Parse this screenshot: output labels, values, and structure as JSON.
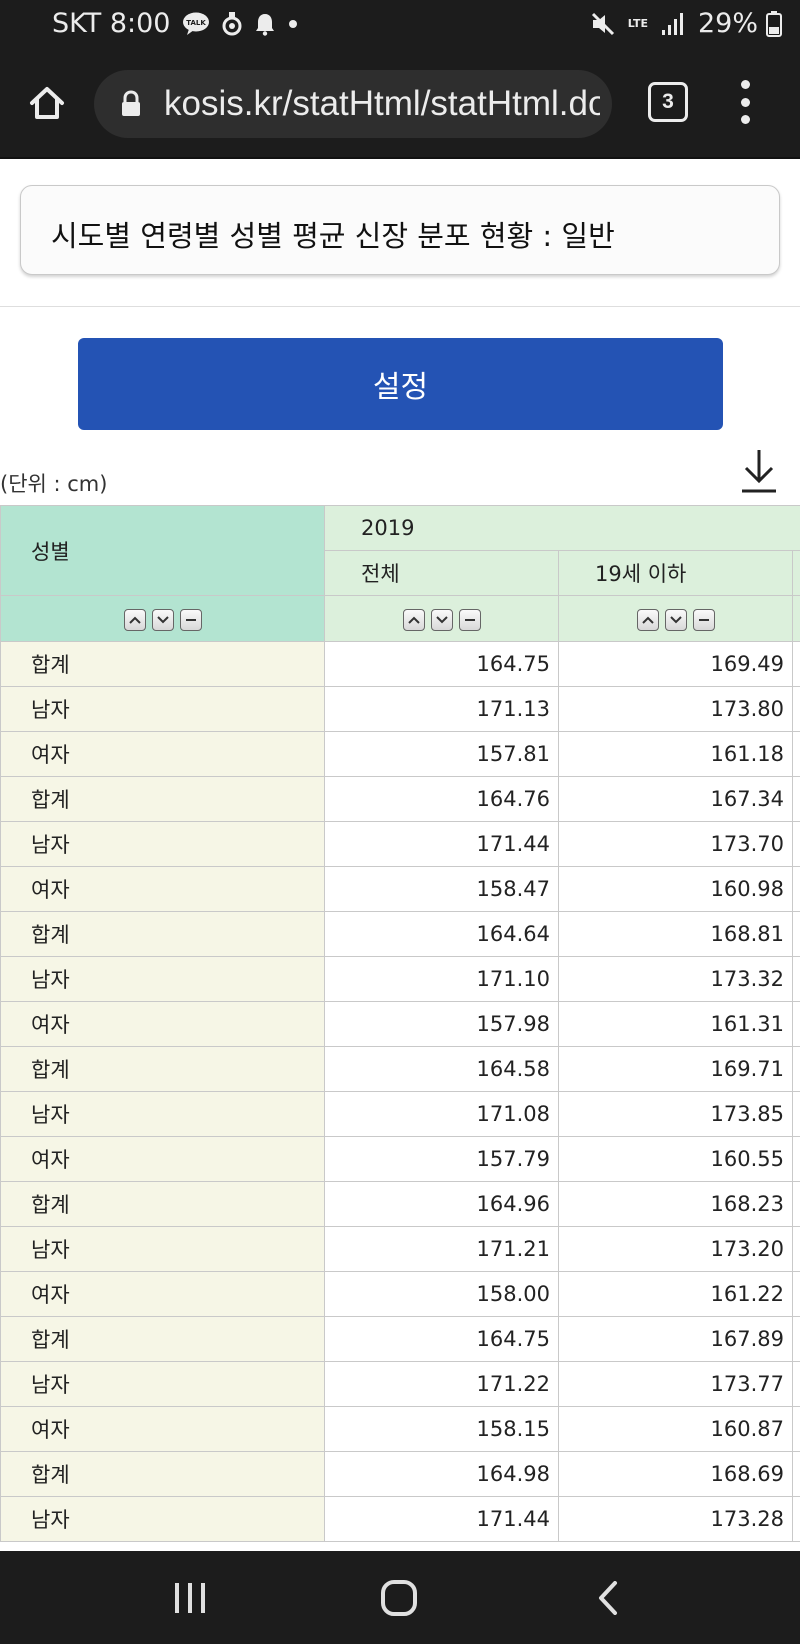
{
  "status_bar": {
    "carrier_time": "SKT 8:00",
    "talk_badge": "TALK",
    "network": "LTE",
    "battery": "29%"
  },
  "browser": {
    "url": "kosis.kr/statHtml/statHtml.do",
    "tab_count": "3"
  },
  "page": {
    "title": "시도별 연령별 성별 평균 신장 분포 현황 : 일반",
    "settings_button": "설정",
    "unit": "(단위 : cm)"
  },
  "table": {
    "row_header": "성별",
    "year": "2019",
    "columns": [
      "전체",
      "19세 이하"
    ],
    "rows": [
      {
        "label": "합계",
        "values": [
          "164.75",
          "169.49"
        ]
      },
      {
        "label": "남자",
        "values": [
          "171.13",
          "173.80"
        ]
      },
      {
        "label": "여자",
        "values": [
          "157.81",
          "161.18"
        ]
      },
      {
        "label": "합계",
        "values": [
          "164.76",
          "167.34"
        ]
      },
      {
        "label": "남자",
        "values": [
          "171.44",
          "173.70"
        ]
      },
      {
        "label": "여자",
        "values": [
          "158.47",
          "160.98"
        ]
      },
      {
        "label": "합계",
        "values": [
          "164.64",
          "168.81"
        ]
      },
      {
        "label": "남자",
        "values": [
          "171.10",
          "173.32"
        ]
      },
      {
        "label": "여자",
        "values": [
          "157.98",
          "161.31"
        ]
      },
      {
        "label": "합계",
        "values": [
          "164.58",
          "169.71"
        ]
      },
      {
        "label": "남자",
        "values": [
          "171.08",
          "173.85"
        ]
      },
      {
        "label": "여자",
        "values": [
          "157.79",
          "160.55"
        ]
      },
      {
        "label": "합계",
        "values": [
          "164.96",
          "168.23"
        ]
      },
      {
        "label": "남자",
        "values": [
          "171.21",
          "173.20"
        ]
      },
      {
        "label": "여자",
        "values": [
          "158.00",
          "161.22"
        ]
      },
      {
        "label": "합계",
        "values": [
          "164.75",
          "167.89"
        ]
      },
      {
        "label": "남자",
        "values": [
          "171.22",
          "173.77"
        ]
      },
      {
        "label": "여자",
        "values": [
          "158.15",
          "160.87"
        ]
      },
      {
        "label": "합계",
        "values": [
          "164.98",
          "168.69"
        ]
      },
      {
        "label": "남자",
        "values": [
          "171.44",
          "173.28"
        ]
      }
    ]
  },
  "icons": {
    "status": [
      "talk-icon",
      "location-icon",
      "bell-icon",
      "dot-icon",
      "mute-icon",
      "signal-icon",
      "battery-icon"
    ],
    "browser": [
      "home-icon",
      "lock-icon",
      "tabs-icon",
      "more-icon"
    ],
    "page": [
      "download-icon",
      "sort-up-icon",
      "sort-down-icon",
      "remove-icon"
    ],
    "nav": [
      "recents-icon",
      "home-nav-icon",
      "back-icon"
    ]
  },
  "colors": {
    "status_bg": "#1c1c1c",
    "button_blue": "#2453b4",
    "header_teal": "#b3e4d1",
    "header_green": "#dcf0dc",
    "row_label_bg": "#f6f6e6"
  }
}
